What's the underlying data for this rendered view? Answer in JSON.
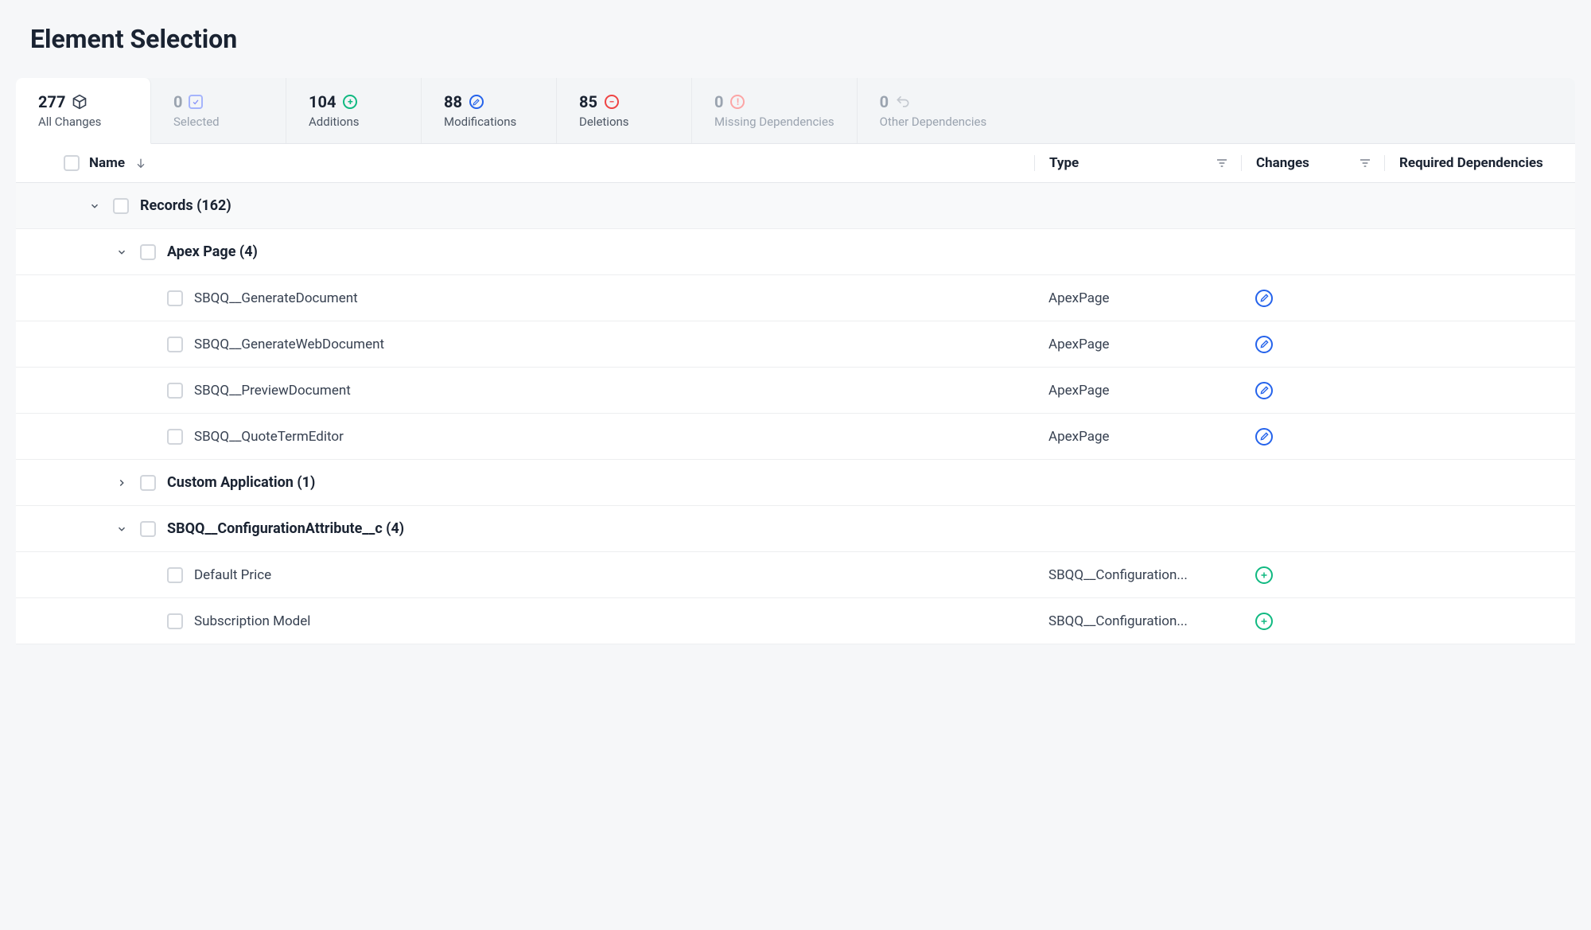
{
  "pageTitle": "Element Selection",
  "tabs": [
    {
      "count": "277",
      "label": "All Changes",
      "icon": "cube",
      "active": true,
      "hasCount": true
    },
    {
      "count": "0",
      "label": "Selected",
      "icon": "check-square",
      "active": false,
      "hasCount": false
    },
    {
      "count": "104",
      "label": "Additions",
      "icon": "plus-circle",
      "active": false,
      "hasCount": true
    },
    {
      "count": "88",
      "label": "Modifications",
      "icon": "edit-circle",
      "active": false,
      "hasCount": true
    },
    {
      "count": "85",
      "label": "Deletions",
      "icon": "minus-circle",
      "active": false,
      "hasCount": true
    },
    {
      "count": "0",
      "label": "Missing Dependencies",
      "icon": "alert-circle",
      "active": false,
      "hasCount": false
    },
    {
      "count": "0",
      "label": "Other Dependencies",
      "icon": "undo-circle",
      "active": false,
      "hasCount": false
    }
  ],
  "columns": {
    "name": "Name",
    "type": "Type",
    "changes": "Changes",
    "deps": "Required Dependencies"
  },
  "tree": {
    "recordsGroup": "Records (162)",
    "apexGroup": "Apex Page (4)",
    "apexItems": [
      {
        "name": "SBQQ__GenerateDocument",
        "type": "ApexPage",
        "change": "mod"
      },
      {
        "name": "SBQQ__GenerateWebDocument",
        "type": "ApexPage",
        "change": "mod"
      },
      {
        "name": "SBQQ__PreviewDocument",
        "type": "ApexPage",
        "change": "mod"
      },
      {
        "name": "SBQQ__QuoteTermEditor",
        "type": "ApexPage",
        "change": "mod"
      }
    ],
    "customAppGroup": "Custom Application (1)",
    "configAttrGroup": "SBQQ__ConfigurationAttribute__c (4)",
    "configItems": [
      {
        "name": "Default Price",
        "type": "SBQQ__Configuration...",
        "change": "add"
      },
      {
        "name": "Subscription Model",
        "type": "SBQQ__Configuration...",
        "change": "add"
      }
    ]
  }
}
